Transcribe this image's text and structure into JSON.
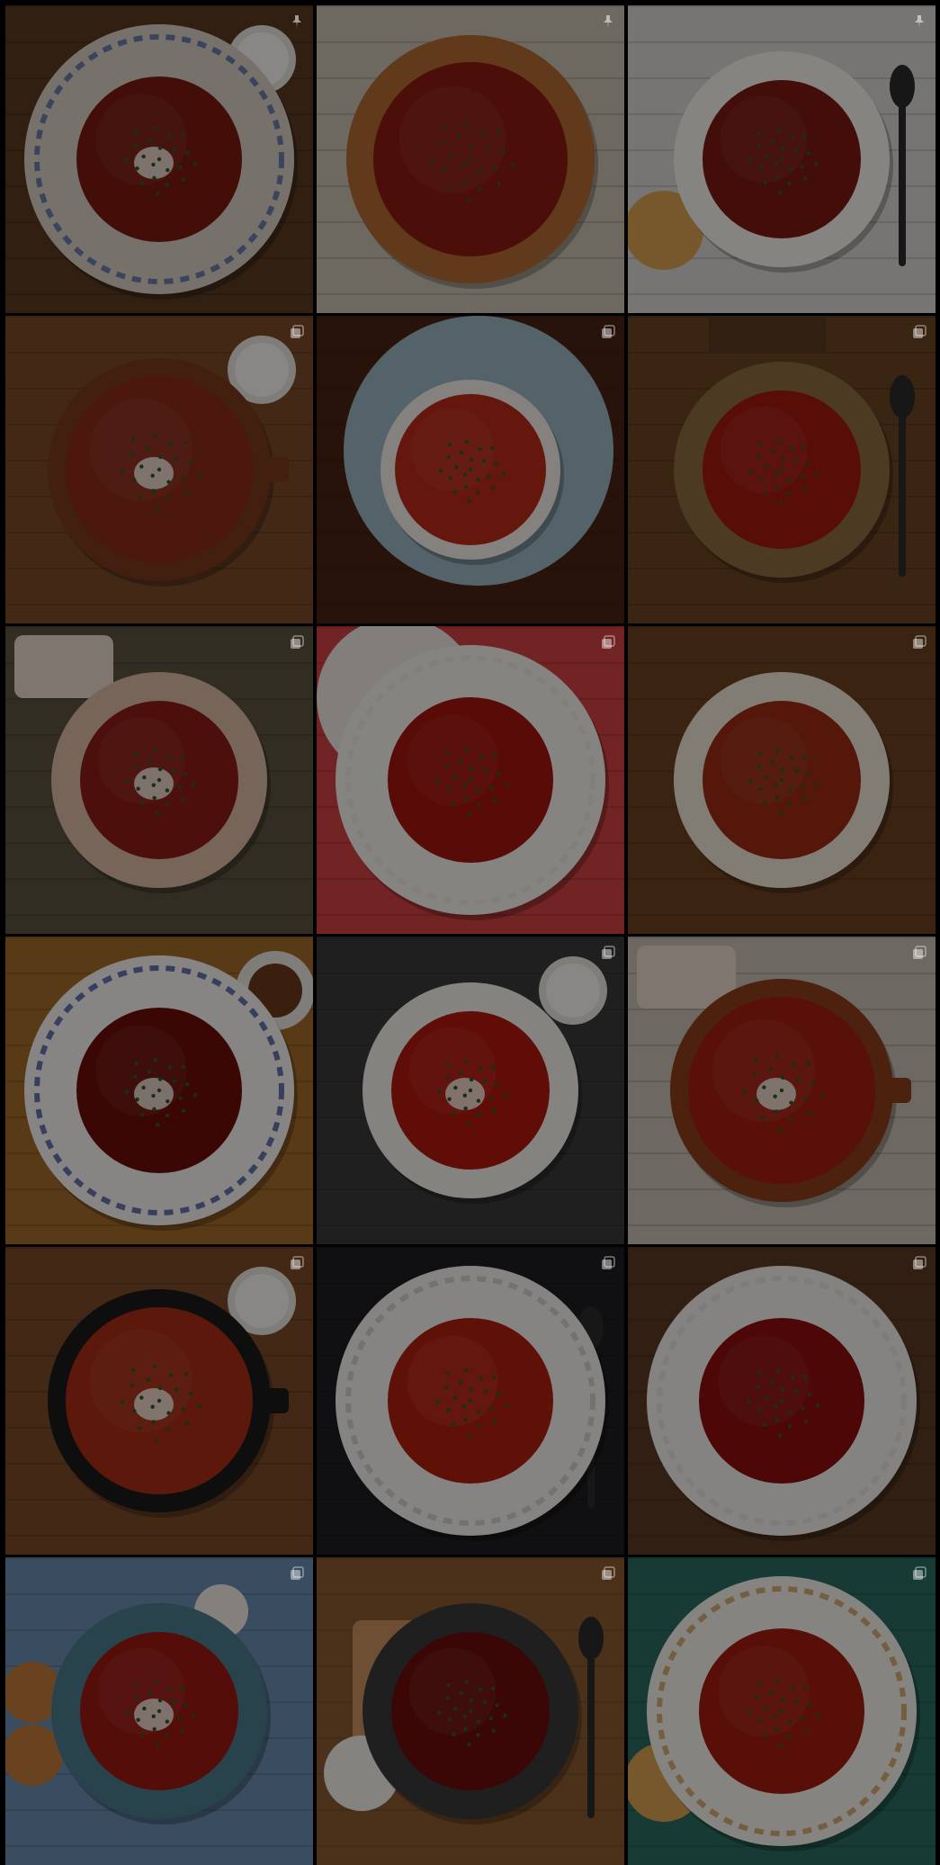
{
  "tiles": [
    {
      "name": "borscht-plate-floral-pinned",
      "badge": "pin-icon",
      "bg": "#5a3a22",
      "dish": "plate",
      "soup": "#7a1a10",
      "rim": "#d8d0c4",
      "accent": "#3c5aa0",
      "side": "sour-cream-bowl"
    },
    {
      "name": "borscht-bread-bowl-pinned",
      "badge": "pin-icon",
      "bg": "#c9bfb0",
      "dish": "bread",
      "soup": "#8a1a12",
      "rim": "#b06a30",
      "accent": "#4a6a9a",
      "side": "none"
    },
    {
      "name": "borscht-white-bowl-spoon-pinned",
      "badge": "pin-icon",
      "bg": "#d8d6d2",
      "dish": "bowl",
      "soup": "#7a1812",
      "rim": "#f2f0ec",
      "accent": "#222",
      "side": "bun-spoon"
    },
    {
      "name": "borscht-clay-pot-sour-cream",
      "badge": "gallery-icon",
      "bg": "#7a4a28",
      "dish": "pot",
      "soup": "#8a2a18",
      "rim": "#7a3a1e",
      "accent": "#f4f2ee",
      "side": "sour-cream-bowl"
    },
    {
      "name": "borscht-white-cup-dark-table",
      "badge": "gallery-icon",
      "bg": "#4a2414",
      "dish": "cup",
      "soup": "#b82a18",
      "rim": "#f0ece6",
      "accent": "#8fb0c0",
      "side": "plate-under"
    },
    {
      "name": "borscht-bowl-bread-spoon",
      "badge": "gallery-icon",
      "bg": "#6a4222",
      "dish": "bowl",
      "soup": "#a0180e",
      "rim": "#8a6a40",
      "accent": "#3a2a1a",
      "side": "bread-spoon"
    },
    {
      "name": "borscht-bowl-with-salo",
      "badge": "gallery-icon",
      "bg": "#5a5240",
      "dish": "bowl",
      "soup": "#8a1c14",
      "rim": "#d8b8a0",
      "accent": "#f4f0e8",
      "side": "salo"
    },
    {
      "name": "borscht-doily-plate-flowers",
      "badge": "gallery-icon",
      "bg": "#d04040",
      "dish": "plate",
      "soup": "#a0140e",
      "rim": "#f2f0ec",
      "accent": "#e8e2da",
      "side": "doily"
    },
    {
      "name": "borscht-cream-bowl-herbs",
      "badge": "gallery-icon",
      "bg": "#6a4220",
      "dish": "bowl",
      "soup": "#9a2a12",
      "rim": "#ece4d6",
      "accent": "#3a6a2a",
      "side": "none"
    },
    {
      "name": "borscht-blue-lattice-plate",
      "badge": "none",
      "bg": "#a06a2a",
      "dish": "plate",
      "soup": "#6a0e0a",
      "rim": "#f4f2f0",
      "accent": "#2a3a8a",
      "side": "sauce-dish"
    },
    {
      "name": "borscht-blue-rim-bowl-board",
      "badge": "gallery-icon",
      "bg": "#3a3a3a",
      "dish": "bowl",
      "soup": "#b0180e",
      "rim": "#f0eeea",
      "accent": "#3a4a8a",
      "side": "cream-cup"
    },
    {
      "name": "borscht-clay-pot-salo",
      "badge": "gallery-icon",
      "bg": "#c8beb4",
      "dish": "pot",
      "soup": "#a01e10",
      "rim": "#8a3c1a",
      "accent": "#f4efe6",
      "side": "salo"
    },
    {
      "name": "borscht-cast-iron-pot-board",
      "badge": "gallery-icon",
      "bg": "#7a4a28",
      "dish": "pot",
      "soup": "#a82c14",
      "rim": "#1a1a1a",
      "accent": "#f4f0e8",
      "side": "cream-cup"
    },
    {
      "name": "borscht-white-plate-dark-mat",
      "badge": "gallery-icon",
      "bg": "#1e1e22",
      "dish": "plate",
      "soup": "#b0200e",
      "rim": "#f2f0ee",
      "accent": "#c0c0c0",
      "side": "spoon"
    },
    {
      "name": "borscht-wide-white-plate",
      "badge": "gallery-icon",
      "bg": "#5a3a24",
      "dish": "plate",
      "soup": "#8a0e0c",
      "rim": "#f0eeec",
      "accent": "#e0dcd8",
      "side": "none"
    },
    {
      "name": "borscht-blue-plate-buns-onion",
      "badge": "gallery-icon",
      "bg": "#6a8ab0",
      "dish": "bowl",
      "soup": "#9a1810",
      "rim": "#4a7a8a",
      "accent": "#e8dcc8",
      "side": "buns-onion"
    },
    {
      "name": "borscht-dark-bowl-toasts",
      "badge": "gallery-icon",
      "bg": "#8a5a30",
      "dish": "bowl",
      "soup": "#6a0e0c",
      "rim": "#3a3a3a",
      "accent": "#f4f0ea",
      "side": "toasts-spoon"
    },
    {
      "name": "borscht-scalloped-plate-teal",
      "badge": "gallery-icon",
      "bg": "#2a6a60",
      "dish": "plate",
      "soup": "#a01c10",
      "rim": "#f4f0ec",
      "accent": "#c88a40",
      "side": "buns"
    }
  ]
}
